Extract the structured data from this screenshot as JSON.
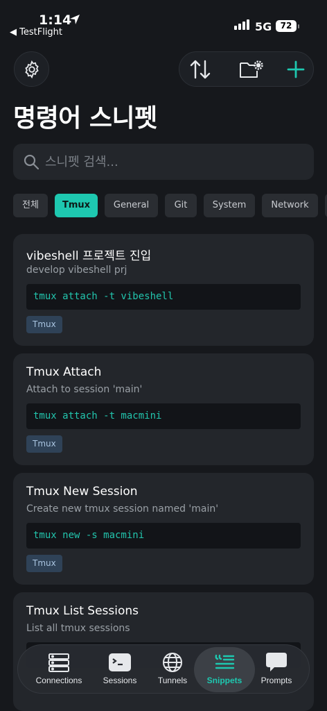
{
  "status": {
    "time": "1:14",
    "back_label": "◀ TestFlight",
    "network": "5G",
    "battery": "72",
    "signal_bars": 4
  },
  "title": "명령어 스니펫",
  "search": {
    "placeholder": "스니펫 검색..."
  },
  "chips": [
    {
      "label": "전체"
    },
    {
      "label": "Tmux",
      "active": true
    },
    {
      "label": "General"
    },
    {
      "label": "Git"
    },
    {
      "label": "System"
    },
    {
      "label": "Network"
    }
  ],
  "snippets": [
    {
      "title": "vibeshell 프로젝트 진입",
      "description": "develop vibeshell prj",
      "command": "tmux attach -t vibeshell",
      "tag": "Tmux"
    },
    {
      "title": "Tmux Attach",
      "description": "Attach to session 'main'",
      "command": "tmux attach -t macmini",
      "tag": "Tmux"
    },
    {
      "title": "Tmux New Session",
      "description": "Create new tmux session named 'main'",
      "command": "tmux new -s macmini",
      "tag": "Tmux"
    },
    {
      "title": "Tmux List Sessions",
      "description": "List all tmux sessions",
      "command": "",
      "tag": ""
    }
  ],
  "tabs": [
    {
      "label": "Connections",
      "icon": "server-icon"
    },
    {
      "label": "Sessions",
      "icon": "terminal-icon"
    },
    {
      "label": "Tunnels",
      "icon": "globe-icon"
    },
    {
      "label": "Snippets",
      "icon": "quote-list-icon",
      "active": true
    },
    {
      "label": "Prompts",
      "icon": "speech-bubble-icon"
    }
  ],
  "colors": {
    "accent": "#1ec8b0",
    "background": "#16181c",
    "card": "#23262b",
    "tag_bg": "#2f4257"
  }
}
